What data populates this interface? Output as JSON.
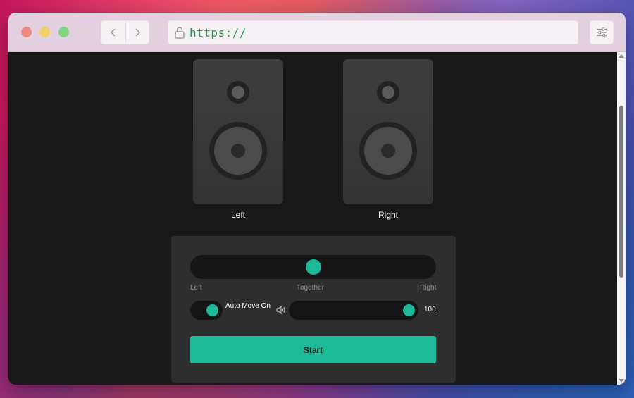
{
  "browser": {
    "url": "https://",
    "back_icon": "chevron-left-icon",
    "forward_icon": "chevron-right-icon",
    "lock_icon": "lock-icon",
    "menu_icon": "sliders-icon"
  },
  "speakers": [
    {
      "label": "Left"
    },
    {
      "label": "Right"
    }
  ],
  "pan": {
    "value": 0.5,
    "label_left": "Left",
    "label_center": "Together",
    "label_right": "Right"
  },
  "auto_move": {
    "label": "Auto Move On",
    "on": true
  },
  "volume": {
    "icon": "speaker-volume-icon",
    "value": 100,
    "value_text": "100"
  },
  "start_button": {
    "label": "Start"
  },
  "colors": {
    "accent": "#1db999",
    "background": "#181818",
    "panel": "#2e2e2e"
  }
}
